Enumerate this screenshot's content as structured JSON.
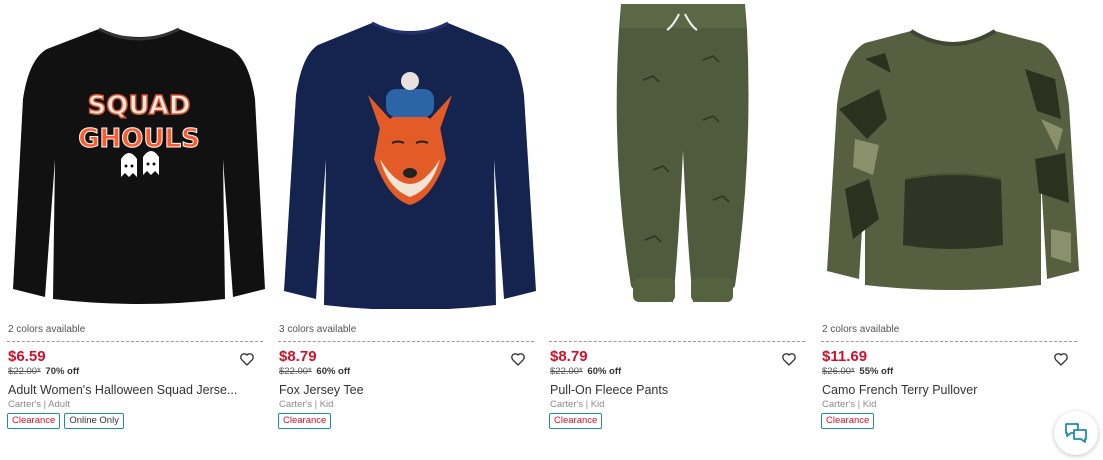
{
  "products": [
    {
      "colors": "2 colors available",
      "price": "$6.59",
      "original_price": "$22.00*",
      "discount": "70% off",
      "name": "Adult Women's Halloween Squad Jerse...",
      "meta": "Carter's | Adult",
      "badges": [
        "Clearance",
        "Online Only"
      ],
      "image_text": [
        "SQUAD",
        "GHOULS"
      ]
    },
    {
      "colors": "3 colors available",
      "price": "$8.79",
      "original_price": "$22.00*",
      "discount": "60% off",
      "name": "Fox Jersey Tee",
      "meta": "Carter's | Kid",
      "badges": [
        "Clearance"
      ]
    },
    {
      "colors": "",
      "price": "$8.79",
      "original_price": "$22.00*",
      "discount": "60% off",
      "name": "Pull-On Fleece Pants",
      "meta": "Carter's | Kid",
      "badges": [
        "Clearance"
      ]
    },
    {
      "colors": "2 colors available",
      "price": "$11.69",
      "original_price": "$26.00*",
      "discount": "55% off",
      "name": "Camo French Terry Pullover",
      "meta": "Carter's | Kid",
      "badges": [
        "Clearance"
      ]
    }
  ],
  "icons": {
    "heart": "heart-outline-icon",
    "chat": "chat-bubbles-icon"
  },
  "colors_palette": {
    "price_red": "#d0112b",
    "badge_border": "#1d8fa8"
  }
}
